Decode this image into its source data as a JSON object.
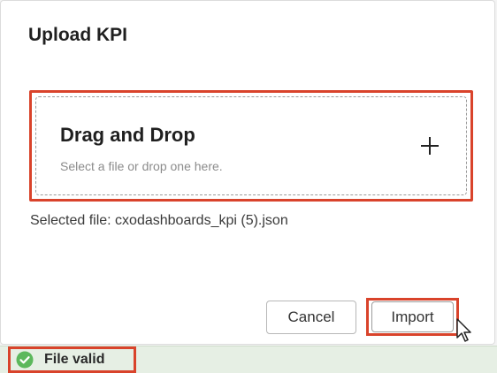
{
  "dialog": {
    "title": "Upload KPI"
  },
  "dropzone": {
    "title": "Drag and Drop",
    "hint": "Select a file or drop one here.",
    "icon": "plus-icon"
  },
  "selected_file": {
    "text": "Selected file: cxodashboards_kpi (5).json"
  },
  "buttons": {
    "cancel_label": "Cancel",
    "import_label": "Import"
  },
  "status": {
    "text": "File valid",
    "icon": "check-circle-icon",
    "color": "#5cb85c"
  },
  "colors": {
    "highlight": "#d9432b",
    "status_bar_bg": "#e6efe4"
  }
}
